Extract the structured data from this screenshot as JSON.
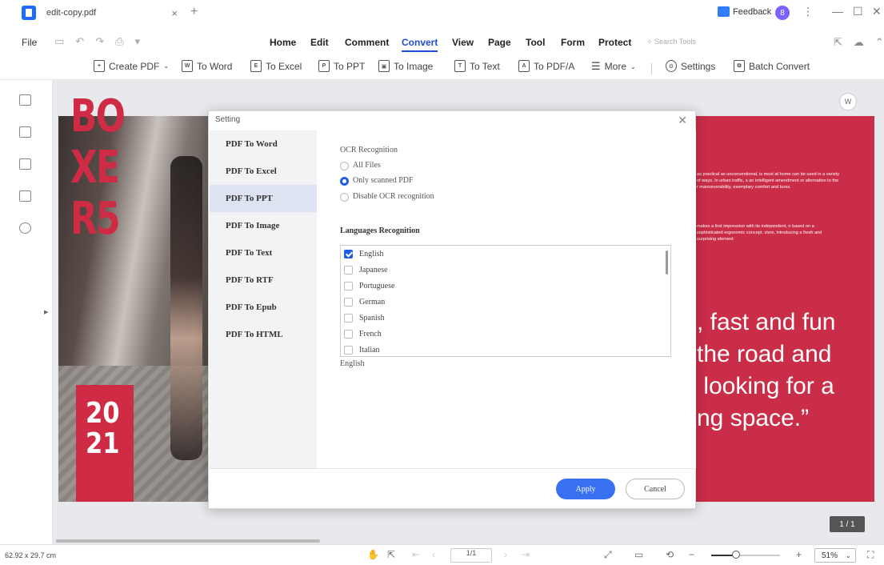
{
  "titlebar": {
    "tab_title": "edit-copy.pdf",
    "tab_close": "×",
    "new_tab": "+",
    "feedback": "Feedback",
    "avatar_initial": "8",
    "more": "⋮",
    "minimize": "—",
    "maximize": "☐",
    "close": "✕"
  },
  "menubar": {
    "file": "File",
    "items": [
      "Home",
      "Edit",
      "Comment",
      "Convert",
      "View",
      "Page",
      "Tool",
      "Form",
      "Protect"
    ],
    "active": "Convert",
    "search_placeholder": "Search Tools"
  },
  "toolbar": {
    "create_pdf": "Create PDF",
    "to_word": "To Word",
    "to_excel": "To Excel",
    "to_ppt": "To PPT",
    "to_image": "To Image",
    "to_text": "To Text",
    "to_pdfa": "To PDF/A",
    "more": "More",
    "settings": "Settings",
    "batch_convert": "Batch Convert"
  },
  "document": {
    "boxer_lines": [
      "BO",
      "XE",
      "R5"
    ],
    "year_lines": [
      "20",
      "21"
    ],
    "red_paragraph_1": "as practical as unconventional, is most at home can be used in a variety of ways. In urban traffic, s an intelligent amendment or alternative to the r manoeuvrability, exemplary comfort and tures.",
    "red_paragraph_2": "makes a first impression with its independent, n based on a sophisticated ergonomic concept. vivre, introducing a fresh and surprising element",
    "quote": ", fast and fun\nthe road and\n looking for a\nng space.”",
    "page_badge": "1 / 1"
  },
  "dialog": {
    "title": "Setting",
    "nav": [
      "PDF To Word",
      "PDF To Excel",
      "PDF To PPT",
      "PDF To Image",
      "PDF To Text",
      "PDF To RTF",
      "PDF To Epub",
      "PDF To HTML"
    ],
    "selected_nav": "PDF To PPT",
    "ocr_heading": "OCR Recognition",
    "ocr_options": [
      "All Files",
      "Only scanned PDF",
      "Disable OCR recognition"
    ],
    "ocr_selected": "Only scanned PDF",
    "lang_heading": "Languages Recognition",
    "languages": [
      "English",
      "Japanese",
      "Portuguese",
      "German",
      "Spanish",
      "French",
      "Italian"
    ],
    "languages_checked": [
      "English"
    ],
    "selected_summary": "English",
    "apply": "Apply",
    "cancel": "Cancel"
  },
  "statusbar": {
    "dimensions": "62.92 x 29.7 cm",
    "page_field": "1/1",
    "zoom": "51%",
    "zoom_level": 0.51
  },
  "colors": {
    "accent": "#1f5fe6",
    "brand_red": "#cf2b45",
    "apply_button": "#3770f0"
  }
}
